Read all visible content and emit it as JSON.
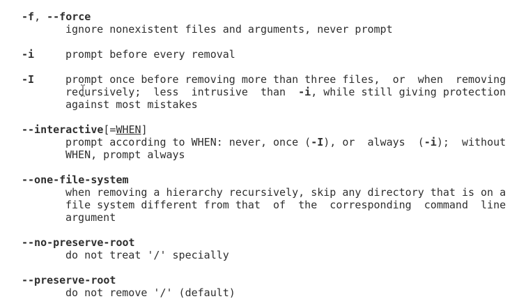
{
  "man_page": {
    "options": [
      {
        "flag_short": "-f",
        "sep": ", ",
        "flag_long": "--force",
        "desc": [
          "ignore nonexistent files and arguments, never prompt"
        ]
      },
      {
        "flag": "-i",
        "desc": [
          "prompt before every removal"
        ]
      },
      {
        "flag": "-I",
        "desc_l1": "prompt once before removing more than three files,  or  when  removing",
        "desc_l2_pre": "recursively;  less  intrusive  than  ",
        "desc_l2_flag": "-i",
        "desc_l2_post": ", while still giving protection",
        "desc_l3": "against most mistakes"
      },
      {
        "flag": "--interactive",
        "arg_open": "[=",
        "arg": "WHEN",
        "arg_close": "]",
        "desc_l1_a": "prompt according to WHEN: never, once (",
        "desc_l1_flag1": "-I",
        "desc_l1_b": "), or  always  (",
        "desc_l1_flag2": "-i",
        "desc_l1_c": ");  without",
        "desc_l2": "WHEN, prompt always"
      },
      {
        "flag": "--one-file-system",
        "desc": [
          "when removing a hierarchy recursively, skip any directory that is on a",
          "file system different from that  of  the  corresponding  command  line",
          "argument"
        ]
      },
      {
        "flag": "--no-preserve-root",
        "desc": [
          "do not treat '/' specially"
        ]
      },
      {
        "flag": "--preserve-root",
        "desc": [
          "do not remove '/' (default)"
        ]
      }
    ]
  }
}
